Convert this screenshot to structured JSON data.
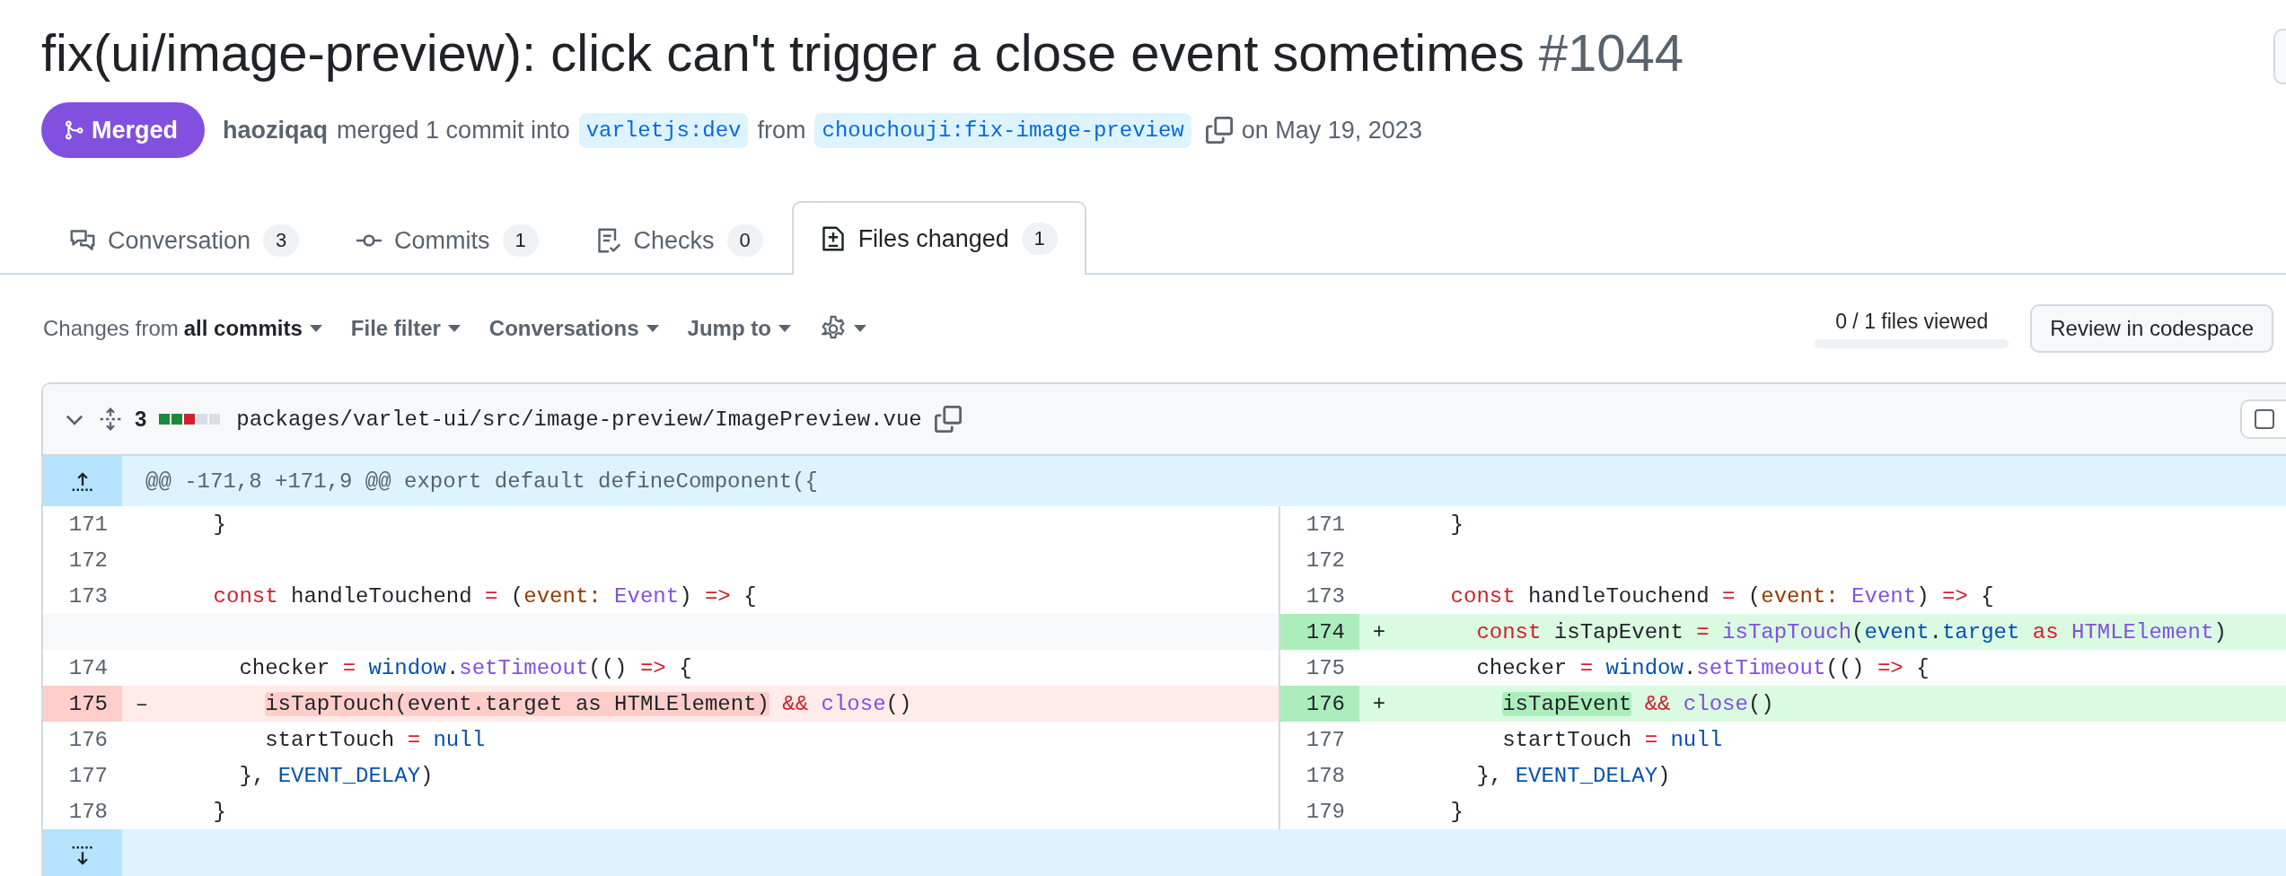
{
  "title": {
    "text": "fix(ui/image-preview): click can't trigger a close event sometimes",
    "number": "#1044"
  },
  "meta": {
    "state": "Merged",
    "author": "haoziqaq",
    "action": "merged 1 commit into",
    "base": "varletjs:dev",
    "from": "from",
    "head": "chouchouji:fix-image-preview",
    "date": "on May 19, 2023"
  },
  "tabs": [
    {
      "label": "Conversation",
      "count": "3",
      "selected": false
    },
    {
      "label": "Commits",
      "count": "1",
      "selected": false
    },
    {
      "label": "Checks",
      "count": "0",
      "selected": false
    },
    {
      "label": "Files changed",
      "count": "1",
      "selected": true
    }
  ],
  "toolbar": {
    "changes_prefix": "Changes from",
    "changes_value": "all commits",
    "menus": [
      "File filter",
      "Conversations",
      "Jump to"
    ],
    "viewed": {
      "text": "0 / 1 files viewed",
      "level": 0
    },
    "review_button": "Review in codespace"
  },
  "file": {
    "changes": "3",
    "diffstat": [
      {
        "color": "#1f883d"
      },
      {
        "color": "#1f883d"
      },
      {
        "color": "#cf222e"
      },
      {
        "color": "#d8dee4"
      },
      {
        "color": "#d8dee4"
      }
    ],
    "path": "packages/varlet-ui/src/image-preview/ImagePreview.vue",
    "viewed_checked": false,
    "hunk": "@@ -171,8 +171,9 @@ export default defineComponent({",
    "rows": [
      {
        "left": {
          "kind": "context",
          "num": "171",
          "tokens": [
            {
              "kind": "plain",
              "text": "    }"
            }
          ]
        },
        "right": {
          "kind": "context",
          "num": "171",
          "tokens": [
            {
              "kind": "plain",
              "text": "    }"
            }
          ]
        }
      },
      {
        "left": {
          "kind": "context",
          "num": "172"
        },
        "right": {
          "kind": "context",
          "num": "172"
        }
      },
      {
        "left": {
          "kind": "context",
          "num": "173",
          "tokens": [
            {
              "kind": "kw",
              "text": "    const"
            },
            {
              "kind": "plain",
              "text": " handleTouchend "
            },
            {
              "kind": "kw",
              "text": "="
            },
            {
              "kind": "plain",
              "text": " ("
            },
            {
              "kind": "param",
              "text": "event:"
            },
            {
              "kind": "fn",
              "text": " Event"
            },
            {
              "kind": "plain",
              "text": ") "
            },
            {
              "kind": "kw",
              "text": "=>"
            },
            {
              "kind": "plain",
              "text": " {"
            }
          ]
        },
        "right": {
          "kind": "context",
          "num": "173",
          "tokens": [
            {
              "kind": "kw",
              "text": "    const"
            },
            {
              "kind": "plain",
              "text": " handleTouchend "
            },
            {
              "kind": "kw",
              "text": "="
            },
            {
              "kind": "plain",
              "text": " ("
            },
            {
              "kind": "param",
              "text": "event:"
            },
            {
              "kind": "fn",
              "text": " Event"
            },
            {
              "kind": "plain",
              "text": ") "
            },
            {
              "kind": "kw",
              "text": "=>"
            },
            {
              "kind": "plain",
              "text": " {"
            }
          ]
        }
      },
      {
        "left": {
          "kind": "empty"
        },
        "right": {
          "kind": "added",
          "num": "174",
          "sign": "+",
          "tokens": [
            {
              "kind": "kw",
              "text": "      const"
            },
            {
              "kind": "plain",
              "text": " isTapEvent "
            },
            {
              "kind": "kw",
              "text": "="
            },
            {
              "kind": "fn",
              "text": " isTapTouch"
            },
            {
              "kind": "plain",
              "text": "("
            },
            {
              "kind": "var",
              "text": "event"
            },
            {
              "kind": "plain",
              "text": "."
            },
            {
              "kind": "var",
              "text": "target"
            },
            {
              "kind": "kw",
              "text": " as"
            },
            {
              "kind": "fn",
              "text": " HTMLElement"
            },
            {
              "kind": "plain",
              "text": ")"
            }
          ]
        }
      },
      {
        "left": {
          "kind": "context",
          "num": "174",
          "tokens": [
            {
              "kind": "plain",
              "text": "      checker "
            },
            {
              "kind": "kw",
              "text": "="
            },
            {
              "kind": "var",
              "text": " window"
            },
            {
              "kind": "plain",
              "text": "."
            },
            {
              "kind": "fn",
              "text": "setTimeout"
            },
            {
              "kind": "plain",
              "text": "(() "
            },
            {
              "kind": "kw",
              "text": "=>"
            },
            {
              "kind": "plain",
              "text": " {"
            }
          ]
        },
        "right": {
          "kind": "context",
          "num": "175",
          "tokens": [
            {
              "kind": "plain",
              "text": "      checker "
            },
            {
              "kind": "kw",
              "text": "="
            },
            {
              "kind": "var",
              "text": " window"
            },
            {
              "kind": "plain",
              "text": "."
            },
            {
              "kind": "fn",
              "text": "setTimeout"
            },
            {
              "kind": "plain",
              "text": "(() "
            },
            {
              "kind": "kw",
              "text": "=>"
            },
            {
              "kind": "plain",
              "text": " {"
            }
          ]
        }
      },
      {
        "left": {
          "kind": "deleted",
          "num": "175",
          "sign": "–",
          "tokens": [
            {
              "kind": "plain",
              "text": "        isTapTouch(event.target as HTMLElement)",
              "mark": true
            },
            {
              "kind": "kw",
              "text": " &&"
            },
            {
              "kind": "fn",
              "text": " close"
            },
            {
              "kind": "plain",
              "text": "()"
            }
          ]
        },
        "right": {
          "kind": "added",
          "num": "176",
          "sign": "+",
          "tokens": [
            {
              "kind": "plain",
              "text": "        isTapEvent",
              "mark": true
            },
            {
              "kind": "kw",
              "text": " &&"
            },
            {
              "kind": "fn",
              "text": " close"
            },
            {
              "kind": "plain",
              "text": "()"
            }
          ]
        }
      },
      {
        "left": {
          "kind": "context",
          "num": "176",
          "tokens": [
            {
              "kind": "plain",
              "text": "        startTouch "
            },
            {
              "kind": "kw",
              "text": "="
            },
            {
              "kind": "var",
              "text": " null"
            }
          ]
        },
        "right": {
          "kind": "context",
          "num": "177",
          "tokens": [
            {
              "kind": "plain",
              "text": "        startTouch "
            },
            {
              "kind": "kw",
              "text": "="
            },
            {
              "kind": "var",
              "text": " null"
            }
          ]
        }
      },
      {
        "left": {
          "kind": "context",
          "num": "177",
          "tokens": [
            {
              "kind": "plain",
              "text": "      }, "
            },
            {
              "kind": "var",
              "text": "EVENT_DELAY"
            },
            {
              "kind": "plain",
              "text": ")"
            }
          ]
        },
        "right": {
          "kind": "context",
          "num": "178",
          "tokens": [
            {
              "kind": "plain",
              "text": "      }, "
            },
            {
              "kind": "var",
              "text": "EVENT_DELAY"
            },
            {
              "kind": "plain",
              "text": ")"
            }
          ]
        }
      },
      {
        "left": {
          "kind": "context",
          "num": "178",
          "tokens": [
            {
              "kind": "plain",
              "text": "    }"
            }
          ]
        },
        "right": {
          "kind": "context",
          "num": "179",
          "tokens": [
            {
              "kind": "plain",
              "text": "    }"
            }
          ]
        }
      }
    ]
  }
}
